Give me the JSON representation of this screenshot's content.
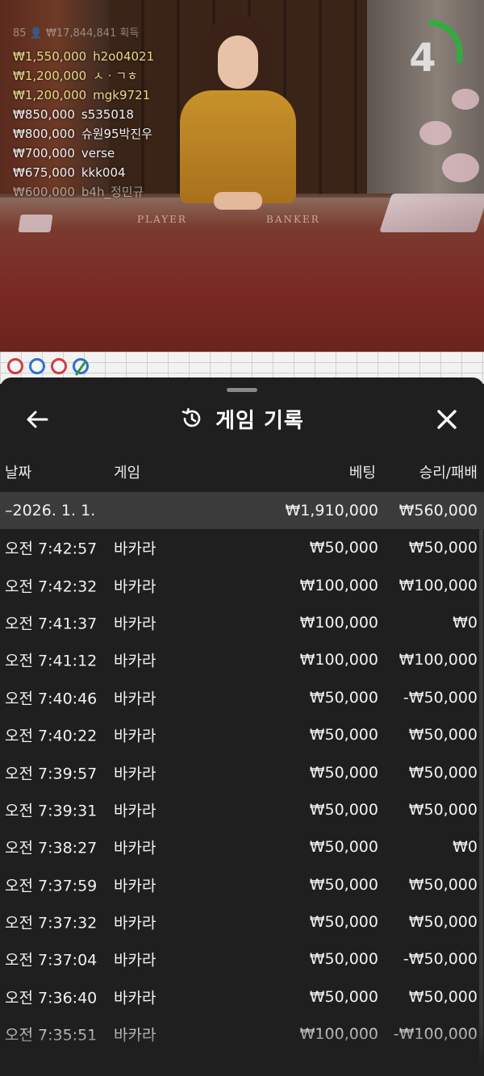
{
  "video": {
    "bets_header": "85 👤 ₩17,844,841 획득",
    "bets": [
      {
        "amount": "₩1,550,000",
        "user": "h2o04021",
        "top": true
      },
      {
        "amount": "₩1,200,000",
        "user": "ㅅ · ㄱㅎ",
        "top": true
      },
      {
        "amount": "₩1,200,000",
        "user": "mgk9721",
        "top": true
      },
      {
        "amount": "₩850,000",
        "user": "s535018",
        "top": false
      },
      {
        "amount": "₩800,000",
        "user": "슈원95박진우",
        "top": false
      },
      {
        "amount": "₩700,000",
        "user": "verse",
        "top": false
      },
      {
        "amount": "₩675,000",
        "user": "kkk004",
        "top": false
      },
      {
        "amount": "₩600,000",
        "user": "b4h_정민규",
        "top": false
      }
    ],
    "table_player": "PLAYER",
    "table_banker": "BANKER",
    "countdown": "4",
    "countdown_progress": 0.3,
    "timer_color": "#2fae3f"
  },
  "road": {
    "circles": [
      {
        "color": "#d33a3a"
      },
      {
        "color": "#2f6fd0"
      },
      {
        "color": "#d33a3a"
      },
      {
        "color": "#2f6fd0",
        "slash": true
      }
    ]
  },
  "sheet": {
    "title": "게임 기록",
    "back_icon": "arrow-left-icon",
    "history_icon": "history-clock-icon",
    "close_icon": "close-x-icon",
    "columns": {
      "date": "날짜",
      "game": "게임",
      "bet": "베팅",
      "winloss": "승리/패배"
    },
    "date_group": {
      "date": "–2026. 1. 1.",
      "bet": "₩1,910,000",
      "winloss": "₩560,000"
    },
    "rows": [
      {
        "time": "오전 7:42:57",
        "game": "바카라",
        "bet": "₩50,000",
        "winloss": "₩50,000"
      },
      {
        "time": "오전 7:42:32",
        "game": "바카라",
        "bet": "₩100,000",
        "winloss": "₩100,000"
      },
      {
        "time": "오전 7:41:37",
        "game": "바카라",
        "bet": "₩100,000",
        "winloss": "₩0"
      },
      {
        "time": "오전 7:41:12",
        "game": "바카라",
        "bet": "₩100,000",
        "winloss": "₩100,000"
      },
      {
        "time": "오전 7:40:46",
        "game": "바카라",
        "bet": "₩50,000",
        "winloss": "-₩50,000"
      },
      {
        "time": "오전 7:40:22",
        "game": "바카라",
        "bet": "₩50,000",
        "winloss": "₩50,000"
      },
      {
        "time": "오전 7:39:57",
        "game": "바카라",
        "bet": "₩50,000",
        "winloss": "₩50,000"
      },
      {
        "time": "오전 7:39:31",
        "game": "바카라",
        "bet": "₩50,000",
        "winloss": "₩50,000"
      },
      {
        "time": "오전 7:38:27",
        "game": "바카라",
        "bet": "₩50,000",
        "winloss": "₩0"
      },
      {
        "time": "오전 7:37:59",
        "game": "바카라",
        "bet": "₩50,000",
        "winloss": "₩50,000"
      },
      {
        "time": "오전 7:37:32",
        "game": "바카라",
        "bet": "₩50,000",
        "winloss": "₩50,000"
      },
      {
        "time": "오전 7:37:04",
        "game": "바카라",
        "bet": "₩50,000",
        "winloss": "-₩50,000"
      },
      {
        "time": "오전 7:36:40",
        "game": "바카라",
        "bet": "₩50,000",
        "winloss": "₩50,000"
      },
      {
        "time": "오전 7:35:51",
        "game": "바카라",
        "bet": "₩100,000",
        "winloss": "-₩100,000"
      }
    ]
  }
}
